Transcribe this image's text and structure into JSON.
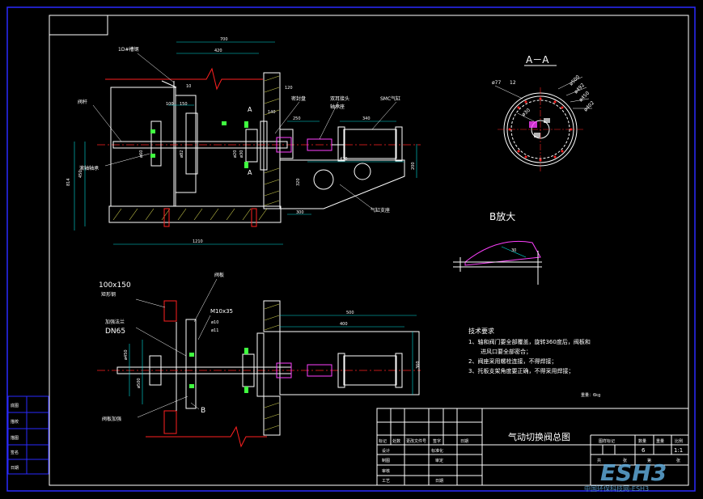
{
  "colors": {
    "background": "#000000",
    "frame": "#2a2aff",
    "line": "#ffffff",
    "dimension": "#00e0e0",
    "red": "#ff2020",
    "magenta": "#ff40ff",
    "yellow": "#ffff60",
    "green": "#40ff40"
  },
  "section_aa": {
    "title": "A－A",
    "dims": [
      "ø500",
      "ø492",
      "ø450",
      "ø402",
      "ø30",
      "ø77",
      "12"
    ]
  },
  "detail_b": {
    "title": "B放大",
    "dim": "30"
  },
  "top_view": {
    "dims": [
      "700",
      "420",
      "10",
      "100",
      "150",
      "140",
      "120",
      "250",
      "340",
      "320",
      "ø60",
      "ø82",
      "ø20",
      "ø30",
      "410",
      "200",
      "300",
      "1210",
      "814",
      "450",
      "120",
      "A",
      "A"
    ],
    "labels": [
      "1D#槽钢",
      "阀杆",
      "密封盘",
      "双耳接头",
      "SMC气缸",
      "轴承座",
      "滚轴轴承",
      "气缸支座",
      "ø10"
    ]
  },
  "bottom_view": {
    "dims": [
      "100x150",
      "M10x35",
      "ø10",
      "ø11",
      "500",
      "400",
      "360",
      "ø450",
      "ø500",
      "B"
    ],
    "labels": [
      "矩形钢",
      "加强法兰",
      "DN65",
      "阀板",
      "阀板加强"
    ]
  },
  "tech_req": {
    "title": "技术要求",
    "items": [
      "1、轴和阀门要全部覆盖，旋转360度后，阀板和",
      "进风口要全部密合；",
      "2、阀座采用螺栓连接，不得焊接；",
      "3、托板支架角度要正确，不得采用焊接；"
    ],
    "note": "重量：6kg"
  },
  "title_block": {
    "title": "气动切换阀总图",
    "header_left": [
      "标记",
      "处数",
      "更改文件号",
      "签字",
      "日期"
    ],
    "rows_left": [
      "设计",
      "制图",
      "审核",
      "工艺"
    ],
    "mid_cells": [
      "标准化",
      "审定",
      "日期"
    ],
    "header_right": [
      "图样标记",
      "数量",
      "重量",
      "比例"
    ],
    "qty": "6",
    "scale": "1:1",
    "sheet": [
      "共",
      "张",
      "第",
      "张"
    ]
  },
  "side_labels": [
    "日期",
    "签名",
    "描图",
    "描校",
    "底图"
  ],
  "watermark": {
    "logo": "ESH3",
    "subtitle": "中国环保科技网-ESH3"
  }
}
